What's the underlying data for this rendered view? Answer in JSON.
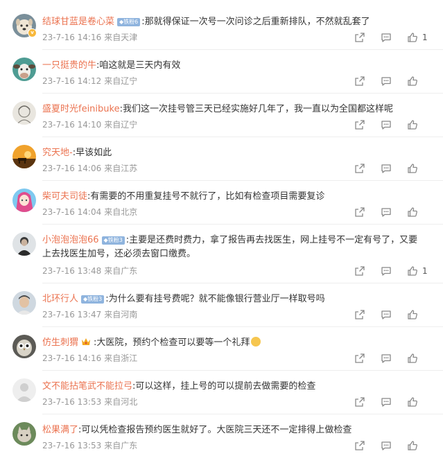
{
  "colors": {
    "username": "#eb7350",
    "meta": "#999999",
    "badge": "#8fb4de"
  },
  "comments": [
    {
      "user": "结球甘蓝是卷心菜",
      "badge": "铁粉6",
      "verified": true,
      "text": ":那就得保证一次号一次问诊之后重新排队，不然就乱套了",
      "time": "23-7-16 14:16",
      "location": "来自天津",
      "likes": "1",
      "avatar": "dog-avatar"
    },
    {
      "user": "一只挺贵的牛",
      "text": ":咱这就是三天内有效",
      "time": "23-7-16 14:12",
      "location": "来自辽宁",
      "likes": "",
      "avatar": "cow-avatar"
    },
    {
      "user": "盛夏时光feinibuke",
      "text": ":我们这一次挂号管三天已经实施好几年了，我一直以为全国都这样呢",
      "time": "23-7-16 14:10",
      "location": "来自辽宁",
      "likes": "",
      "avatar": "sketch-avatar"
    },
    {
      "user": "究天地-",
      "text": ":早该如此",
      "time": "23-7-16 14:06",
      "location": "来自江苏",
      "likes": "",
      "avatar": "sunset-avatar"
    },
    {
      "user": "柴可夫司徒",
      "text": ":有需要的不用重复挂号不就行了，比如有检查项目需要复诊",
      "time": "23-7-16 14:04",
      "location": "来自北京",
      "likes": "",
      "avatar": "anime-avatar"
    },
    {
      "user": "小泡泡泡泡66",
      "badge": "铁粉3",
      "text": ":主要是还费时费力，拿了报告再去找医生，网上挂号不一定有号了，又要",
      "text2": "上去找医生加号，还必须去窗口缴费。",
      "time": "23-7-16 13:48",
      "location": "来自广东",
      "likes": "1",
      "avatar": "person-avatar"
    },
    {
      "user": "北环行人",
      "badge": "铁粉3",
      "text": ":为什么要有挂号费呢？就不能像银行营业厅一样取号吗",
      "time": "23-7-16 13:47",
      "location": "来自河南",
      "likes": "",
      "avatar": "man-avatar"
    },
    {
      "user": "仿生刺猬",
      "text": ":大医院，预约个检查可以要等一个礼拜",
      "time": "23-7-16 14:16",
      "location": "来自浙江",
      "likes": "",
      "avatar": "owl-avatar",
      "crown": true,
      "emoji": true
    },
    {
      "user": "文不能拈笔武不能拉弓",
      "text": ":可以这样，挂上号的可以提前去做需要的检查",
      "time": "23-7-16 13:53",
      "location": "来自河北",
      "likes": "",
      "avatar": "default-avatar"
    },
    {
      "user": "松果满了",
      "text": ":可以凭检查报告预约医生就好了。大医院三天还不一定排得上做检查",
      "time": "23-7-16 13:53",
      "location": "来自广东",
      "likes": "",
      "avatar": "cat-avatar"
    }
  ]
}
